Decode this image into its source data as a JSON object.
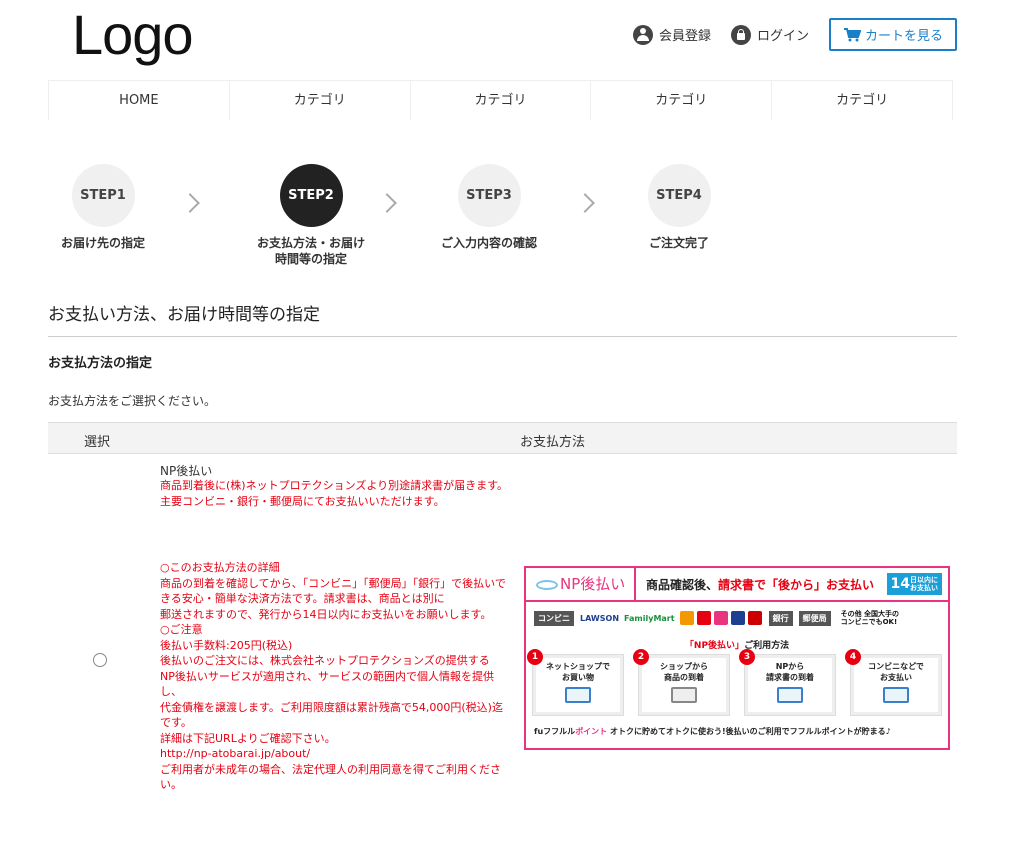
{
  "header": {
    "logo": "Logo",
    "register": "会員登録",
    "login": "ログイン",
    "cart": "カートを見る"
  },
  "nav": [
    "HOME",
    "カテゴリ",
    "カテゴリ",
    "カテゴリ",
    "カテゴリ"
  ],
  "steps": [
    {
      "num": "STEP1",
      "label": "お届け先の指定"
    },
    {
      "num": "STEP2",
      "label": "お支払方法・お届け\n時間等の指定"
    },
    {
      "num": "STEP3",
      "label": "ご入力内容の確認"
    },
    {
      "num": "STEP4",
      "label": "ご注文完了"
    }
  ],
  "page": {
    "title": "お支払い方法、お届け時間等の指定",
    "subtitle": "お支払方法の指定",
    "description": "お支払方法をご選択ください。"
  },
  "table": {
    "col_select": "選択",
    "col_method": "お支払方法"
  },
  "payment": {
    "name": "NP後払い",
    "text": "商品到着後に(株)ネットプロテクションズより別途請求書が届きます。\n主要コンビニ・銀行・郵便局にてお支払いいただけます。",
    "details": "○このお支払方法の詳細\n商品の到着を確認してから、「コンビニ」「郵便局」「銀行」で後払いできる安心・簡単な決済方法です。請求書は、商品とは別に\n郵送されますので、発行から14日以内にお支払いをお願いします。\n○ご注意\n後払い手数料:205円(税込)\n後払いのご注文には、株式会社ネットプロテクションズの提供する\nNP後払いサービスが適用され、サービスの範囲内で個人情報を提供し、\n代金債権を譲渡します。ご利用限度額は累計残高で54,000円(税込)迄です。\n詳細は下記URLよりご確認下さい。\nhttp://np-atobarai.jp/about/\nご利用者が未成年の場合、法定代理人の利用同意を得てご利用ください。"
  },
  "banner": {
    "logo": "NP後払い",
    "headline_a": "商品確認後、",
    "headline_b": "請求書で「後から」お支払い",
    "days": "14",
    "days_small": "日以内に\nお支払い",
    "conveni_tag": "コンビニ",
    "lawson": "LAWSON",
    "familymart": "FamilyMart",
    "bank_tag": "銀行",
    "post_tag": "郵便局",
    "others": "その他 全国大手の\nコンビニでもOK!",
    "guide_a": "「NP後払い」",
    "guide_b": "ご利用方法",
    "flow": [
      {
        "n": "1",
        "text": "ネットショップで\nお買い物"
      },
      {
        "n": "2",
        "text": "ショップから\n商品の到着"
      },
      {
        "n": "3",
        "text": "NPから\n請求書の到着"
      },
      {
        "n": "4",
        "text": "コンビニなどで\nお支払い"
      }
    ],
    "foot_brand": "fuフフルル",
    "foot_point": "ポイント",
    "foot_text": "オトクに貯めてオトクに使おう!後払いのご利用でフフルルポイントが貯まる♪"
  },
  "colors": {
    "accent": "#1a7fc9",
    "alert": "#e60012",
    "np_pink": "#e8337f"
  }
}
